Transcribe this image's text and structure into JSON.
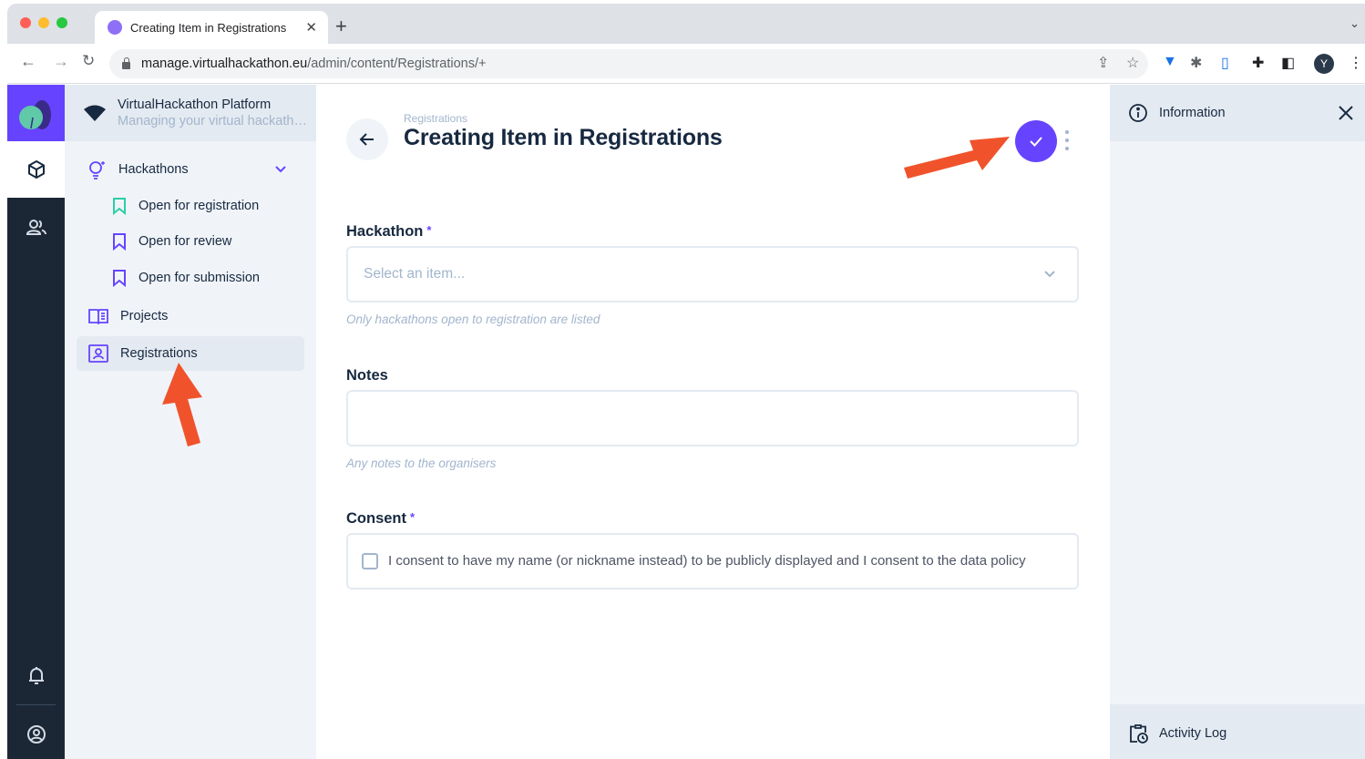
{
  "browser": {
    "tab_title": "Creating Item in Registrations",
    "url_host": "manage.virtualhackathon.eu",
    "url_path": "/admin/content/Registrations/+",
    "profile_initial": "Y"
  },
  "project": {
    "name": "VirtualHackathon Platform",
    "subtitle": "Managing your virtual hackathons"
  },
  "sidebar": {
    "items": [
      {
        "label": "Hackathons"
      },
      {
        "label": "Open for registration"
      },
      {
        "label": "Open for review"
      },
      {
        "label": "Open for submission"
      },
      {
        "label": "Projects"
      },
      {
        "label": "Registrations"
      }
    ]
  },
  "header": {
    "breadcrumb": "Registrations",
    "title": "Creating Item in Registrations"
  },
  "form": {
    "hackathon": {
      "label": "Hackathon",
      "required_mark": "*",
      "placeholder": "Select an item...",
      "hint": "Only hackathons open to registration are listed"
    },
    "notes": {
      "label": "Notes",
      "hint": "Any notes to the organisers"
    },
    "consent": {
      "label": "Consent",
      "required_mark": "*",
      "checkbox_text": "I consent to have my name (or nickname instead) to be publicly displayed and I consent to the data policy"
    }
  },
  "info_panel": {
    "title": "Information",
    "activity_log": "Activity Log"
  },
  "colors": {
    "accent": "#6644ff",
    "rail": "#1b2735",
    "annotation_arrow": "#f0532b"
  }
}
